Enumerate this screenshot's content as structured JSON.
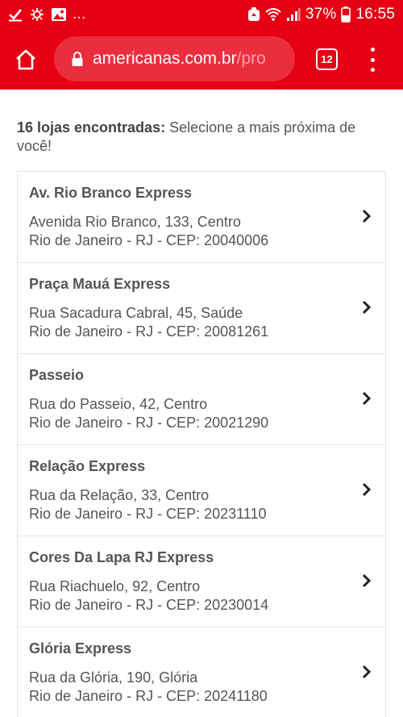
{
  "status_bar": {
    "notification_icons": [
      "check-icon",
      "brightness-icon",
      "image-icon",
      "more-dots"
    ],
    "more_label": "...",
    "battery_percent": "37%",
    "time": "16:55"
  },
  "toolbar": {
    "url_host": "americanas.com.br",
    "url_path": "/pro",
    "tab_count": "12",
    "brand_color": "#e60014"
  },
  "summary": {
    "count_label": "16 lojas encontradas:",
    "prompt": " Selecione a mais próxima de você!"
  },
  "stores": [
    {
      "name": "Av. Rio Branco Express",
      "address": "Avenida Rio Branco, 133, Centro",
      "city": "Rio de Janeiro - RJ - CEP: 20040006"
    },
    {
      "name": "Praça Mauá Express",
      "address": "Rua Sacadura Cabral, 45, Saúde",
      "city": "Rio de Janeiro - RJ - CEP: 20081261"
    },
    {
      "name": "Passeio",
      "address": "Rua do Passeio, 42, Centro",
      "city": "Rio de Janeiro - RJ - CEP: 20021290"
    },
    {
      "name": "Relação Express",
      "address": "Rua da Relação, 33, Centro",
      "city": "Rio de Janeiro - RJ - CEP: 20231110"
    },
    {
      "name": "Cores Da Lapa RJ Express",
      "address": "Rua Riachuelo, 92, Centro",
      "city": "Rio de Janeiro - RJ - CEP: 20230014"
    },
    {
      "name": "Glória Express",
      "address": "Rua da Glória, 190, Glória",
      "city": "Rio de Janeiro - RJ - CEP: 20241180"
    }
  ]
}
